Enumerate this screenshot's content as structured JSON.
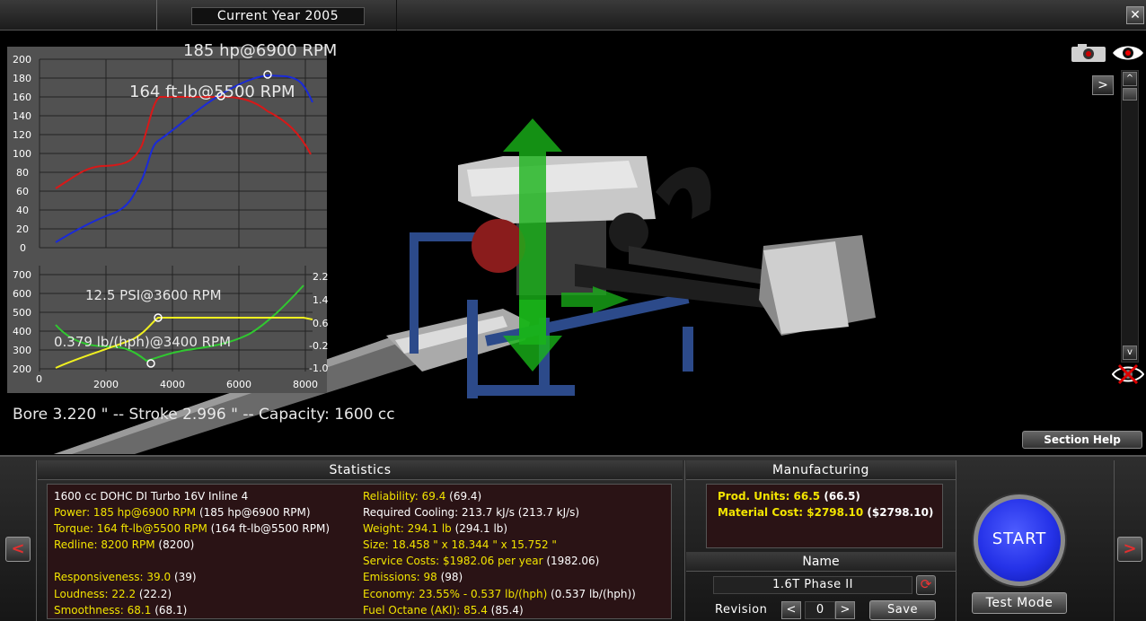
{
  "topbar": {
    "year_label": "Current Year 2005",
    "close_label": "✕"
  },
  "graphs": {
    "torque": {
      "y_ticks": [
        "200",
        "180",
        "160",
        "140",
        "120",
        "100",
        "80",
        "60",
        "40",
        "20",
        "0"
      ],
      "power_peak_label": "185 hp@6900 RPM",
      "torque_peak_label": "164 ft-lb@5500 RPM",
      "power_color": "#1a2ad8",
      "torque_color": "#d81818"
    },
    "boost": {
      "y_ticks_left": [
        "700",
        "600",
        "500",
        "400",
        "300",
        "200"
      ],
      "y_ticks_right": [
        "2.2",
        "1.4",
        "0.6",
        "-0.2",
        "-1.0"
      ],
      "x_ticks": [
        "0",
        "2000",
        "4000",
        "6000",
        "8000"
      ],
      "boost_peak_label": "12.5 PSI@3600 RPM",
      "bsfc_label": "0.379 lb/(hph)@3400 RPM",
      "boost_color": "#f0f020",
      "econ_color": "#30c830"
    },
    "bore_text": "Bore 3.220 \" -- Stroke 2.996 \" -- Capacity: 1600 cc"
  },
  "controls": {
    "expand_label": ">",
    "scroll_up": "^",
    "scroll_down": "v",
    "section_help": "Section Help"
  },
  "statistics": {
    "header": "Statistics",
    "left": [
      {
        "y": "",
        "w": "1600 cc DOHC DI Turbo 16V Inline 4"
      },
      {
        "y": "Power: 185 hp@6900 RPM",
        "w": " (185 hp@6900 RPM)"
      },
      {
        "y": "Torque: 164 ft-lb@5500 RPM",
        "w": " (164 ft-lb@5500 RPM)"
      },
      {
        "y": "Redline: 8200 RPM",
        "w": " (8200)"
      },
      {
        "y": "",
        "w": ""
      },
      {
        "y": "Responsiveness: 39.0",
        "w": " (39)"
      },
      {
        "y": "Loudness: 22.2",
        "w": " (22.2)"
      },
      {
        "y": "Smoothness: 68.1",
        "w": " (68.1)"
      }
    ],
    "right": [
      {
        "y": "Reliability: 69.4",
        "w": " (69.4)"
      },
      {
        "y": "",
        "w": "Required Cooling: 213.7 kJ/s (213.7 kJ/s)"
      },
      {
        "y": "Weight: 294.1 lb",
        "w": " (294.1 lb)"
      },
      {
        "y": "Size: 18.458 \" x 18.344 \" x 15.752 \"",
        "w": ""
      },
      {
        "y": "Service Costs: $1982.06 per year",
        "w": " (1982.06)"
      },
      {
        "y": "Emissions: 98",
        "w": " (98)"
      },
      {
        "y": "Economy: 23.55% - 0.537 lb/(hph)",
        "w": " (0.537 lb/(hph))"
      },
      {
        "y": "Fuel Octane (AKI): 85.4",
        "w": " (85.4)"
      }
    ]
  },
  "manufacturing": {
    "header": "Manufacturing",
    "units_label": "Prod. Units: 66.5",
    "units_paren": " (66.5)",
    "cost_label": "Material Cost: $2798.10",
    "cost_paren": " ($2798.10)"
  },
  "name_section": {
    "header": "Name",
    "name_value": "1.6T Phase II",
    "revision_label": "Revision",
    "revision_value": "0",
    "rev_prev": "<",
    "rev_next": ">",
    "save_label": "Save"
  },
  "actions": {
    "start_label": "START",
    "test_mode_label": "Test Mode",
    "nav_prev": "<",
    "nav_next": ">"
  }
}
